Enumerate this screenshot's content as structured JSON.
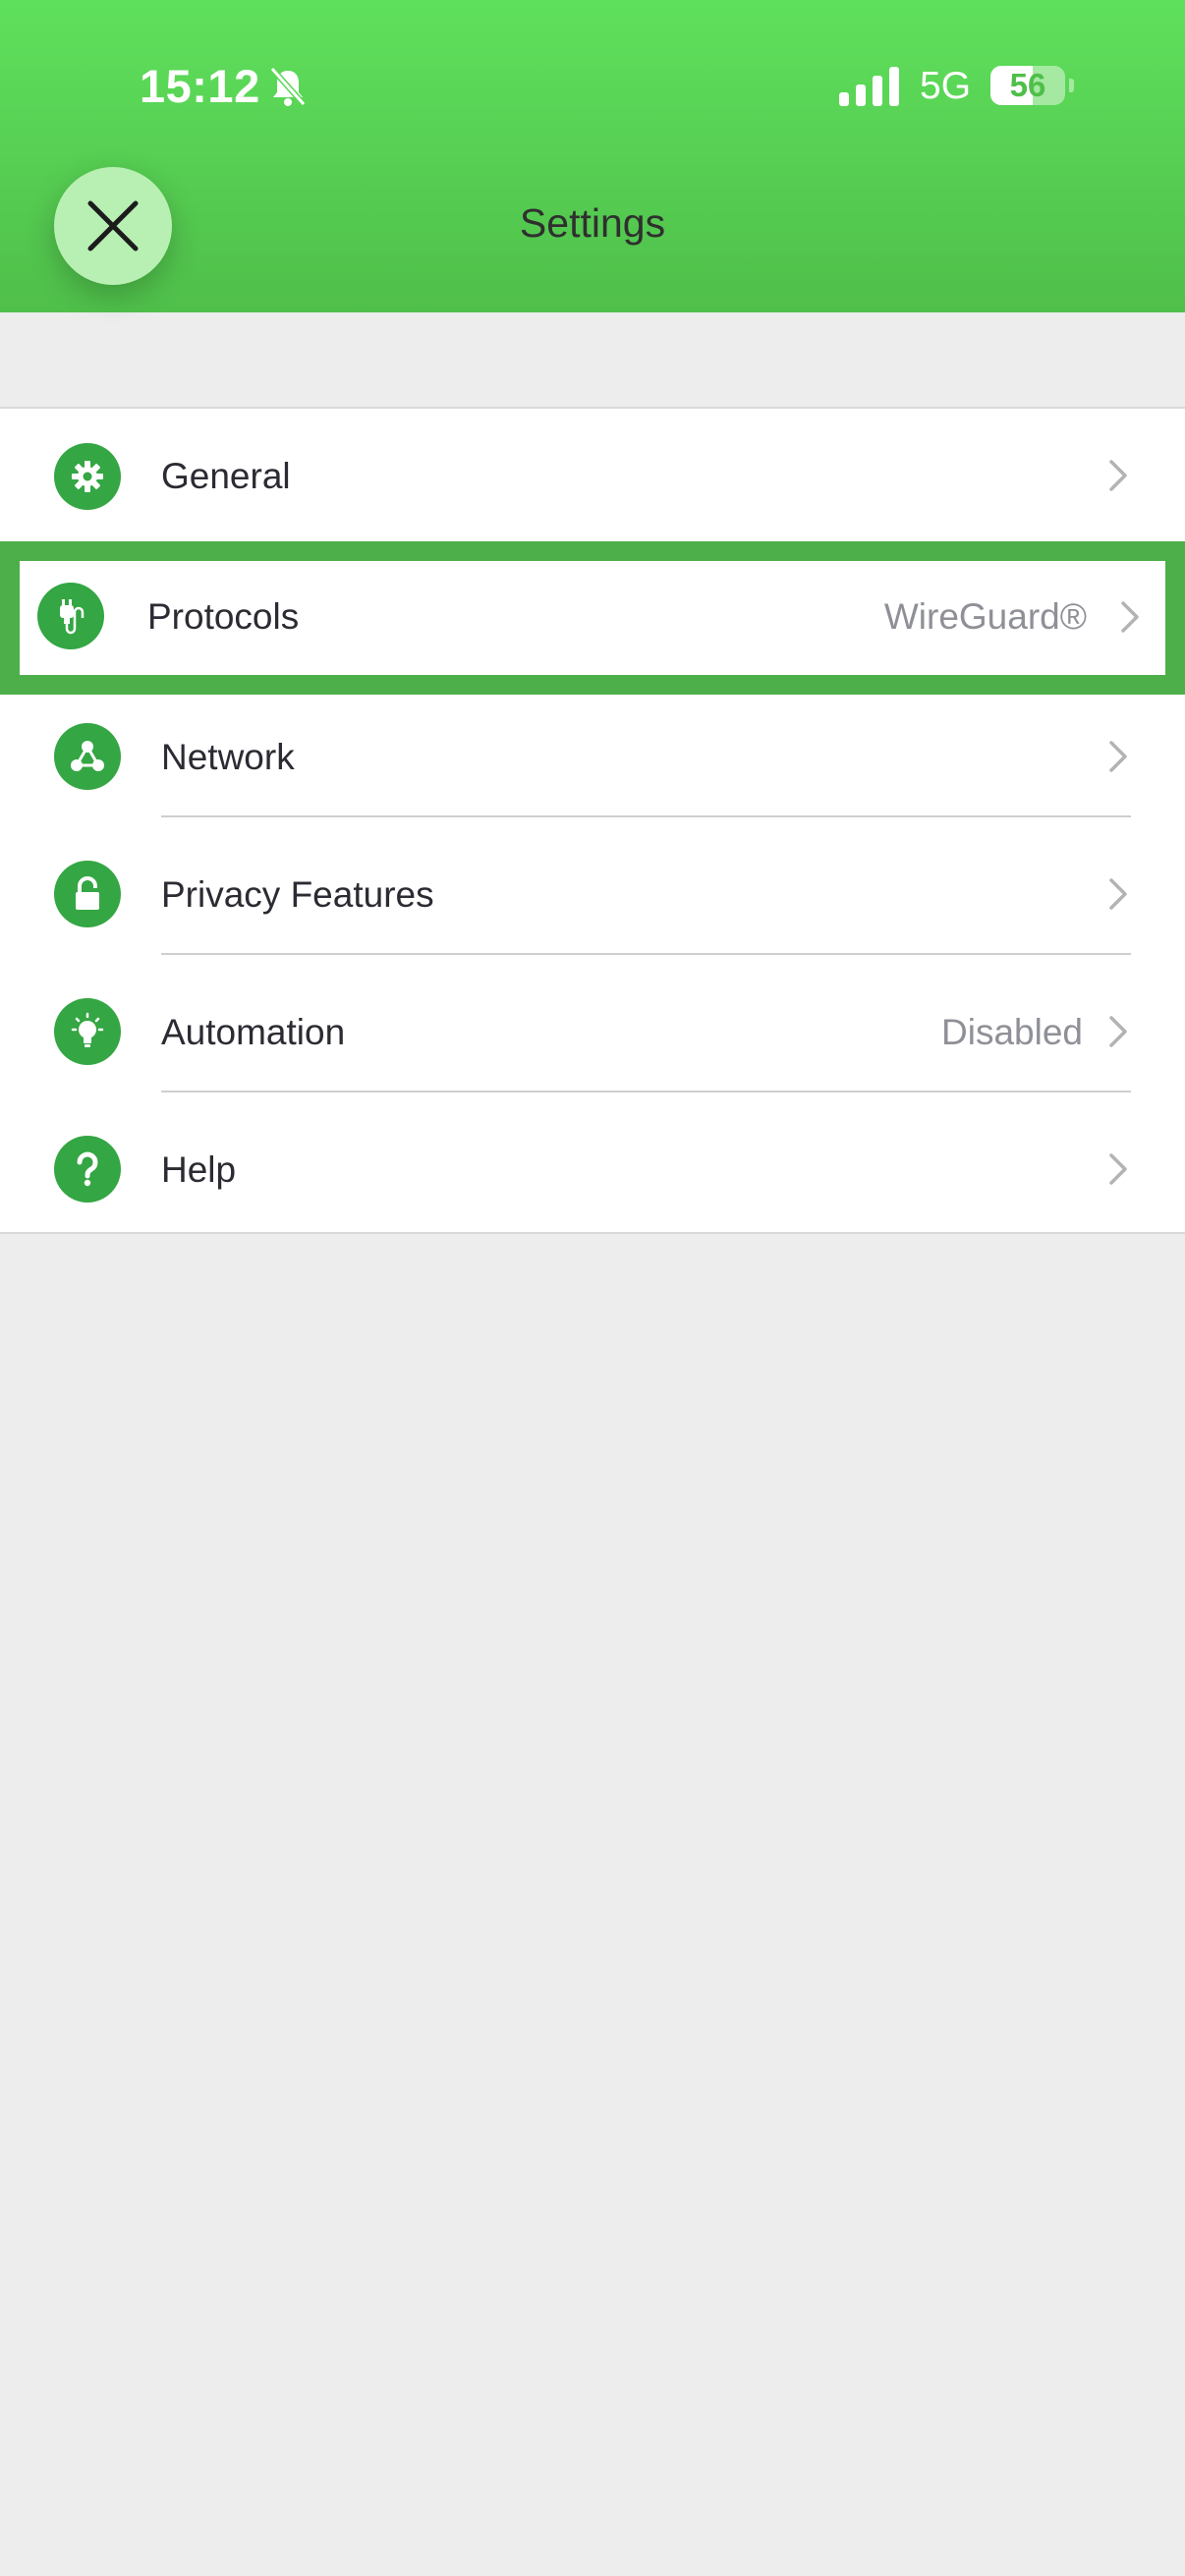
{
  "status_bar": {
    "time": "15:12",
    "network": "5G",
    "battery": "56",
    "battery_level": 0.56
  },
  "header": {
    "title": "Settings"
  },
  "icons": {
    "close": "close-icon",
    "bell": "bell-slash-icon",
    "signal": "signal-bars-icon",
    "general": "gear-icon",
    "protocols": "plug-icon",
    "network": "network-nodes-icon",
    "privacy": "lock-icon",
    "automation": "lightbulb-icon",
    "help": "question-icon",
    "chevron": "chevron-right-icon"
  },
  "colors": {
    "header": "#5fe05c",
    "accent": "#34a643",
    "highlight": "#4caf49"
  },
  "menu": {
    "general": {
      "label": "General",
      "value": ""
    },
    "protocols": {
      "label": "Protocols",
      "value": "WireGuard®"
    },
    "network": {
      "label": "Network",
      "value": ""
    },
    "privacy": {
      "label": "Privacy Features",
      "value": ""
    },
    "automation": {
      "label": "Automation",
      "value": "Disabled"
    },
    "help": {
      "label": "Help",
      "value": ""
    }
  }
}
